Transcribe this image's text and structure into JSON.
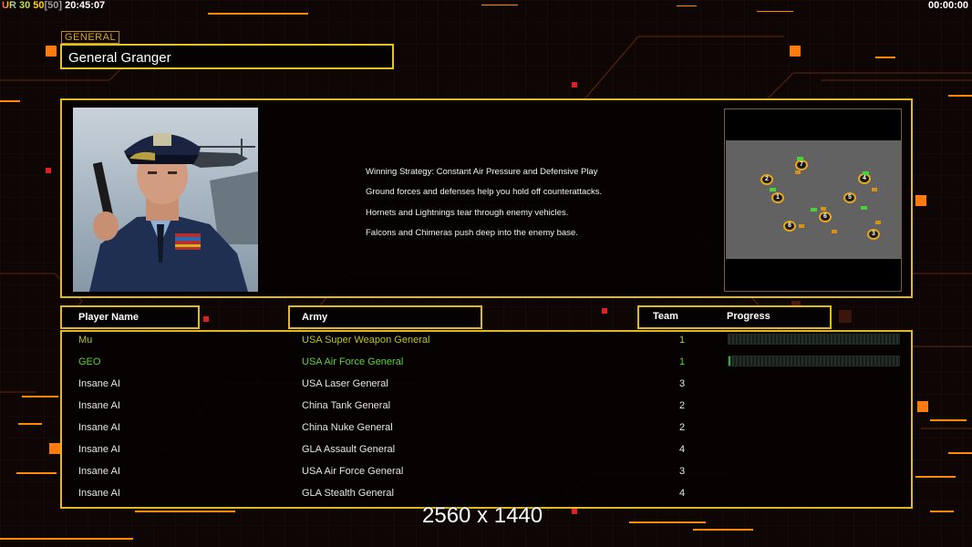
{
  "status_bar": {
    "ur_label": "UR",
    "val1": "30",
    "val2": "50",
    "val3": "[50]",
    "clock": "20:45:07",
    "timer": "00:00:00"
  },
  "general": {
    "tag": "GENERAL",
    "name": "General Granger"
  },
  "strategy": {
    "lines": [
      "Winning Strategy: Constant Air Pressure and Defensive Play",
      "Ground forces and defenses help you hold off counterattacks.",
      "Hornets and Lightnings tear through enemy vehicles.",
      "Falcons and Chimeras push deep into the enemy base."
    ]
  },
  "minimap": {
    "spawns": [
      "1",
      "2",
      "3",
      "4",
      "5",
      "6",
      "7",
      "8"
    ]
  },
  "table": {
    "headers": {
      "player": "Player Name",
      "army": "Army",
      "team": "Team",
      "progress": "Progress"
    },
    "rows": [
      {
        "player": "Mu",
        "army": "USA Super Weapon General",
        "team": "1",
        "progress": 0.0,
        "color": "#b9c41c"
      },
      {
        "player": "GEO",
        "army": "USA Air Force General",
        "team": "1",
        "progress": 0.01,
        "color": "#5ed03a"
      },
      {
        "player": "Insane AI",
        "army": "USA Laser General",
        "team": "3",
        "progress": null,
        "color": "#e8e4de"
      },
      {
        "player": "Insane AI",
        "army": "China Tank General",
        "team": "2",
        "progress": null,
        "color": "#e8e4de"
      },
      {
        "player": "Insane AI",
        "army": "China Nuke General",
        "team": "2",
        "progress": null,
        "color": "#e8e4de"
      },
      {
        "player": "Insane AI",
        "army": "GLA Assault General",
        "team": "4",
        "progress": null,
        "color": "#e8e4de"
      },
      {
        "player": "Insane AI",
        "army": "USA Air Force General",
        "team": "3",
        "progress": null,
        "color": "#e8e4de"
      },
      {
        "player": "Insane AI",
        "army": "GLA Stealth General",
        "team": "4",
        "progress": null,
        "color": "#e8e4de"
      }
    ]
  },
  "resolution_label": "2560 x 1440",
  "colors": {
    "frame": "#e2b91c",
    "accent_orange": "#ff7a10",
    "background": "#0e0605"
  }
}
